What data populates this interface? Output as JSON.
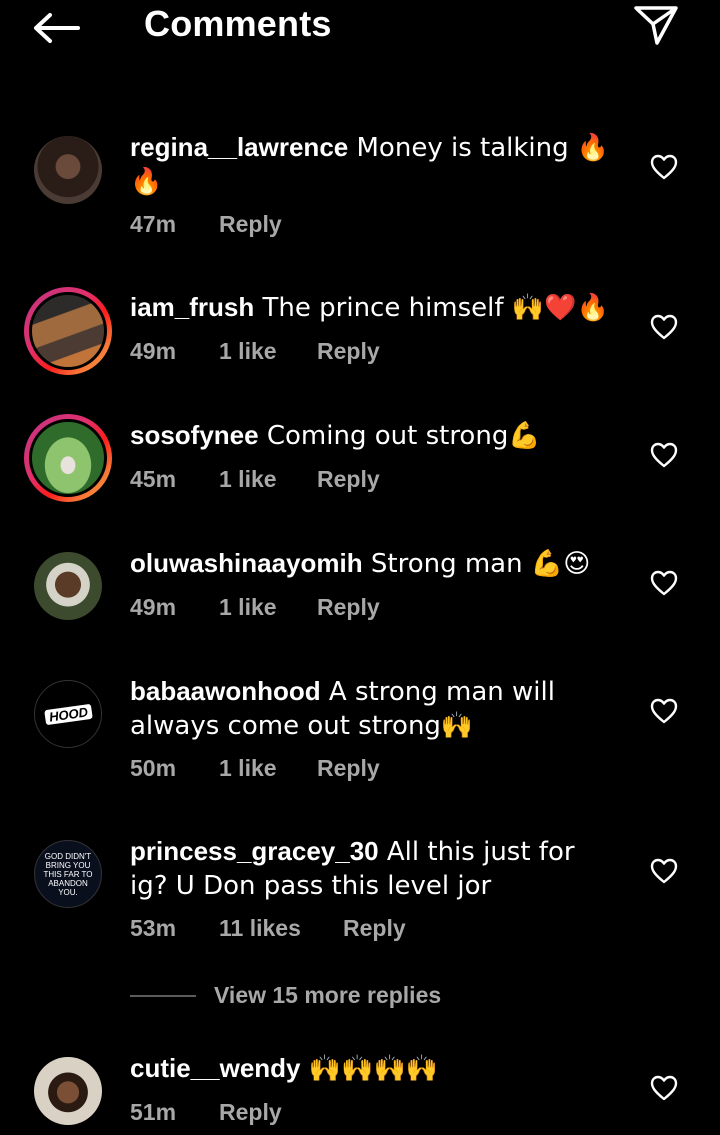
{
  "header": {
    "title": "Comments",
    "back_icon": "arrow-left-icon",
    "share_icon": "paper-plane-icon"
  },
  "comments": [
    {
      "username": "regina__lawrence",
      "text": " Money is talking 🔥 🔥",
      "time": "47m",
      "likes": "",
      "reply": "Reply",
      "story_ring": false,
      "avatar_colors": [
        "#3a2a22",
        "#6a4a3a"
      ]
    },
    {
      "username": "iam_frush",
      "text": " The prince himself 🙌❤️🔥",
      "time": "49m",
      "likes": "1 like",
      "reply": "Reply",
      "story_ring": true,
      "avatar_colors": [
        "#4b3b33",
        "#a06a3f"
      ]
    },
    {
      "username": "sosofynee",
      "text": " Coming out strong💪",
      "time": "45m",
      "likes": "1 like",
      "reply": "Reply",
      "story_ring": true,
      "avatar_colors": [
        "#2f6b2a",
        "#8fc46f"
      ]
    },
    {
      "username": "oluwashinaayomih",
      "text": " Strong man 💪😍",
      "time": "49m",
      "likes": "1 like",
      "reply": "Reply",
      "story_ring": false,
      "avatar_colors": [
        "#3c4a2e",
        "#b7b08a"
      ]
    },
    {
      "username": "babaawonhood",
      "text": " A strong man will always come out strong🙌",
      "time": "50m",
      "likes": "1 like",
      "reply": "Reply",
      "story_ring": false,
      "avatar_colors": [
        "#000000",
        "#000000"
      ],
      "avatar_text": "HOOD"
    },
    {
      "username": "princess_gracey_30",
      "text": " All this just for ig? U Don pass this level jor",
      "time": "53m",
      "likes": "11 likes",
      "reply": "Reply",
      "story_ring": false,
      "avatar_colors": [
        "#0a0f1e",
        "#0a0f1e"
      ],
      "avatar_text": "GOD DIDN'T BRING YOU THIS FAR TO ABANDON YOU."
    },
    {
      "username": "cutie__wendy",
      "text": " 🙌🙌🙌🙌",
      "time": "51m",
      "likes": "",
      "reply": "Reply",
      "story_ring": false,
      "avatar_colors": [
        "#3b2a20",
        "#d9d2c4"
      ]
    }
  ],
  "view_more": {
    "label": "View 15 more replies"
  },
  "colors": {
    "background": "#000000",
    "text": "#ffffff",
    "secondary_text": "#a8a8a8"
  }
}
